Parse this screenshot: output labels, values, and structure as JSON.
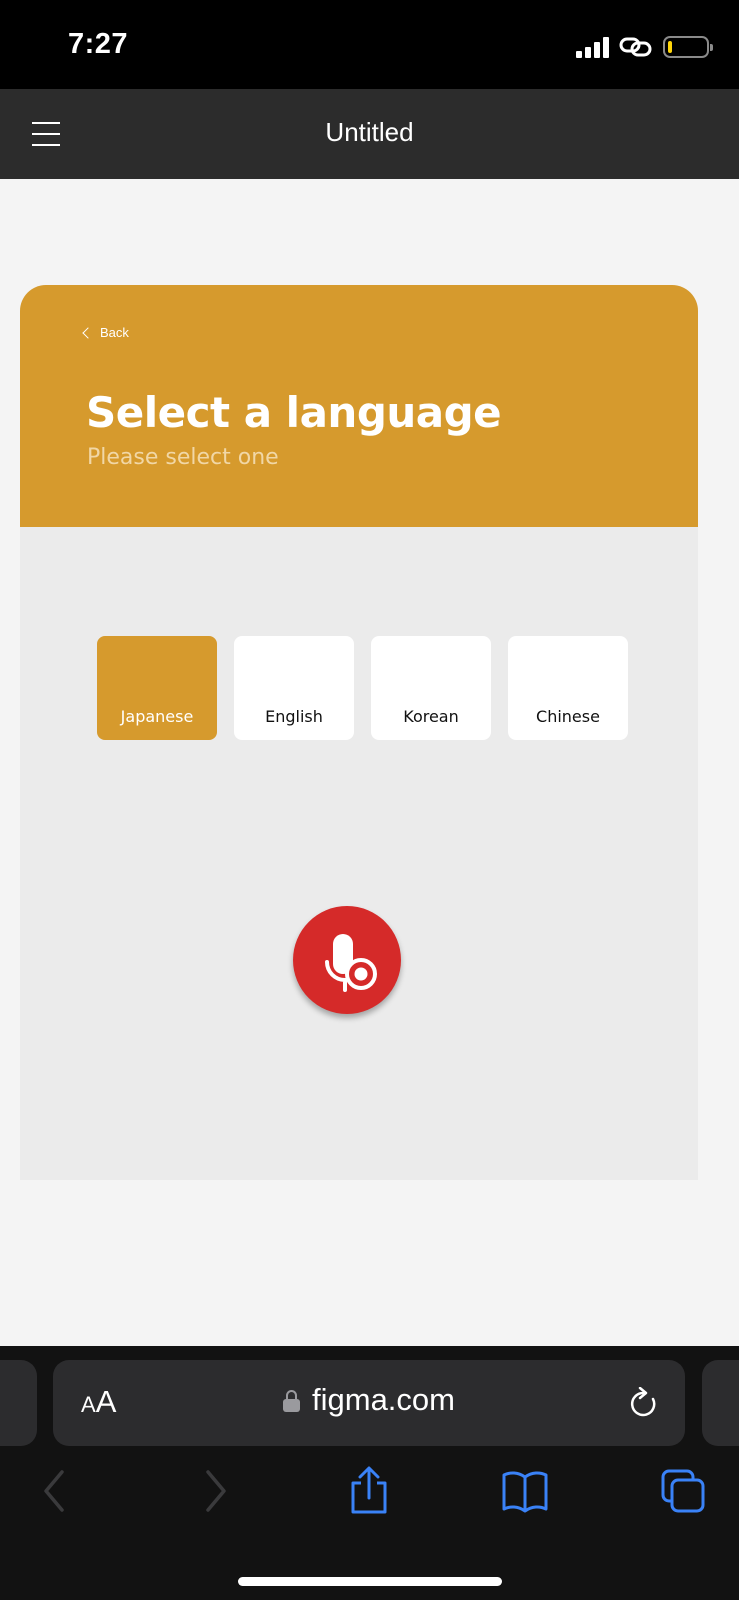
{
  "status_bar": {
    "time": "7:27",
    "battery_level": 0.1,
    "colors": {
      "battery_fill": "#ffd60a"
    }
  },
  "app_header": {
    "title": "Untitled",
    "menu_icon": "hamburger-menu-icon"
  },
  "frame": {
    "back_label": "Back",
    "heading": "Select a language",
    "subheading": "Please select one",
    "languages": [
      {
        "label": "Japanese",
        "selected": true
      },
      {
        "label": "English",
        "selected": false
      },
      {
        "label": "Korean",
        "selected": false
      },
      {
        "label": "Chinese",
        "selected": false
      }
    ],
    "mic_icon": "microphone-record-icon",
    "colors": {
      "accent": "#d69a2d",
      "record": "#d52a29",
      "panel": "#ebebeb"
    }
  },
  "browser": {
    "text_size_small": "A",
    "text_size_large": "A",
    "url": "figma.com",
    "icons": [
      "lock-icon",
      "reload-icon",
      "back-arrow-icon",
      "forward-arrow-icon",
      "share-icon",
      "bookmarks-icon",
      "tabs-icon"
    ],
    "colors": {
      "toolbar_active": "#3a82f7",
      "toolbar_disabled": "#3a3a3c"
    }
  }
}
